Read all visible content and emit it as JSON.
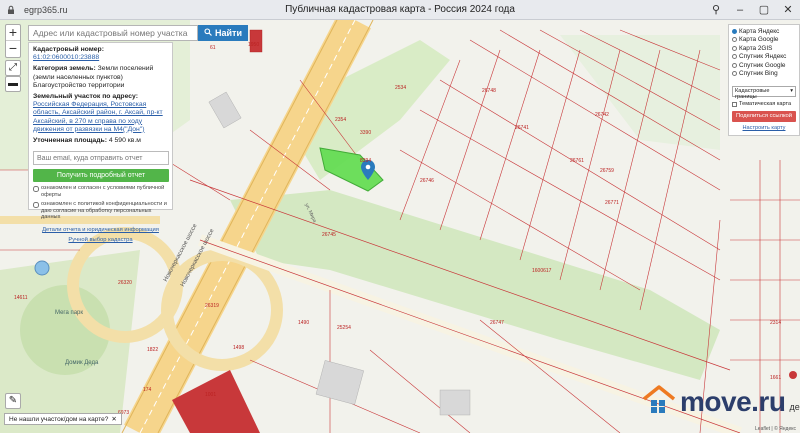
{
  "browser": {
    "url": "egrp365.ru",
    "page_title": "Публичная кадастровая карта - Россия 2024 года"
  },
  "search": {
    "placeholder": "Адрес или кадастровый номер участка",
    "button_label": "Найти"
  },
  "info": {
    "cadastral_label": "Кадастровый номер:",
    "cadastral_value": "61:02:0600010:23888",
    "category_label": "Категория земель:",
    "category_value": "Земли поселений (земли населенных пунктов)",
    "use_value": "Благоустройство территории",
    "address_label": "Земельный участок по адресу:",
    "address_value": "Российская Федерация, Ростовская область, Аксайский район, г. Аксай, пр-кт Аксайский, в 270 м справа по ходу движения от развязки на М4(\"Дон\")",
    "area_label": "Уточненная площадь:",
    "area_value": "4 590 кв.м",
    "email_placeholder": "Ваш email, куда отправить отчет",
    "report_button": "Получить подробный отчет",
    "consent_1": "ознакомлен и согласен с условиями публичной оферты",
    "consent_2": "ознакомлен с политикой конфиденциальности и даю согласие на обработку персональных данных",
    "details_link": "Детали отчета и юридическая информация",
    "manual_link": "Ручной выбор кадастра"
  },
  "layers": {
    "options": [
      "Карта Яндекс",
      "Карта Google",
      "Карта 2GIS",
      "Спутник Яндекс",
      "Спутник Google",
      "Спутник Bing"
    ],
    "selected": "Карта Яндекс",
    "boundaries_select": "Кадастровые границы",
    "thematic_label": "Тематическая карта",
    "share_button": "Поделиться ссылкой",
    "configure_link": "Настроить карту"
  },
  "map_labels": {
    "road_1": "Новочеркасское шоссе",
    "road_2": "Новочеркасское шоссе",
    "road_3": "ул. Мира",
    "park": "Мега парк",
    "park2": "Домик Деда",
    "numbers": [
      "1950",
      "14611",
      "26320",
      "26319",
      "26745",
      "26746",
      "26748",
      "26741",
      "3390",
      "8394",
      "2354",
      "2534",
      "1498",
      "1490",
      "1822",
      "6973",
      "174",
      "25254",
      "26761",
      "26759",
      "26771",
      "26742",
      "26747",
      "1600617",
      "2314",
      "1661",
      "1001",
      "61"
    ]
  },
  "bottom": {
    "not_found": "Не нашли участок/дом на карте?",
    "watermark": "move.ru",
    "watermark_trunc": "деко",
    "attribution": "Leaflet | © Яндекс"
  },
  "colors": {
    "plot_fill": "#66dd55",
    "accent_blue": "#2a7bbd",
    "report_green": "#52b549",
    "share_red": "#d9534f",
    "parcel_red": "#c8383a"
  }
}
